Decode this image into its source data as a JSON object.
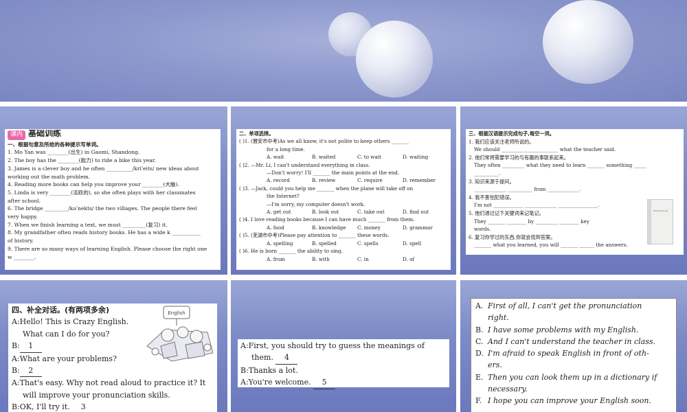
{
  "slide4": {
    "heading": "四、补全对话。(有两项多余)",
    "sign_text": "English",
    "lines": [
      {
        "a": "A:Hello! This is Crazy English.",
        "b": "What can I do for you?"
      },
      {
        "prefix": "B:",
        "blank": "1"
      },
      {
        "a": "A:What are your problems?"
      },
      {
        "prefix": "B:",
        "blank": "2"
      },
      {
        "a": "A:That's easy.  Why not read aloud to practice it? It",
        "b": "will improve your pronunciation skills."
      },
      {
        "prefix": "B:OK, I'll try it.",
        "blank": "3"
      }
    ]
  },
  "slide5": {
    "l1": "A:First, you should try to guess the meanings of",
    "l2": "them.",
    "b4": "4",
    "l3": "B:Thanks a lot.",
    "l4": "A:You're welcome.",
    "b5": "5"
  },
  "slide6": {
    "options": [
      {
        "k": "A.",
        "t": "First of all, I can't get the pronunciation",
        "c": "right."
      },
      {
        "k": "B.",
        "t": "I have some problems with my English."
      },
      {
        "k": "C.",
        "t": "And I can't understand the teacher in class."
      },
      {
        "k": "D.",
        "t": "I'm afraid to speak English in front of oth-",
        "c": "ers."
      },
      {
        "k": "E.",
        "t": "Then you can look them up in a dictionary if",
        "c": "necessary."
      },
      {
        "k": "F.",
        "t": "I hope you can improve your English soon."
      }
    ]
  },
  "slide1": {
    "badge": "课内",
    "title": "基础训练",
    "section": "一、根据句意及所给的各种提示写单词。",
    "lines": [
      "1. Mo Yan was ________(出生) in Gaomi, Shandong.",
      "2. The boy has the ________(能力) to ride a bike this year.",
      "3. James is a clever boy and he often __________/kriˈeits/ new ideas about",
      "working out the math problem.",
      "4. Reading more books can help you improve your ________(大脑).",
      "5. Linda is very ________(活跃的), so she often plays with her classmates",
      "after school.",
      "6. The bridge _________/kəˈnekts/ the two villages. The people there feel",
      "very happy.",
      "7. When we finish learning a text, we must _________(复习) it.",
      "8. My grandfather often reads history books.  He has a wide k ___________",
      "of history.",
      "9. There are so many ways of learning English.  Please choose the right one",
      "w ________."
    ]
  },
  "slide2": {
    "section": "二、单项选择。",
    "items": [
      {
        "q": "(   )1. (雅安市中考)As we all know, it's not polite to keep others _______",
        "q2": "for a long time.",
        "opts": [
          "A. wait",
          "B. waited",
          "C. to wait",
          "D. waiting"
        ]
      },
      {
        "q": "(   )2. —Mr. Li, I can't understand everything in class.",
        "q2": "—Don't worry! I'll _______ the main points at the end.",
        "opts": [
          "A. record",
          "B. review",
          "C. require",
          "D. remember"
        ]
      },
      {
        "q": "(   )3. —Jack, could you help me _______ when the plane will take off on",
        "q2": "the Internet?",
        "q3": "—I'm sorry, my computer doesn't work.",
        "opts": [
          "A. get out",
          "B. look out",
          "C. take out",
          "D. find out"
        ]
      },
      {
        "q": "(   )4. I love reading books because I can have much _______ from them.",
        "opts": [
          "A. food",
          "B. knowledge",
          "C. money",
          "D. grammar"
        ]
      },
      {
        "q": "(   )5. (芜湖市中考)Please pay attention to _______ these words.",
        "opts": [
          "A. spelling",
          "B. spelled",
          "C. spells",
          "D. spell"
        ]
      },
      {
        "q": "(   )6. He is born _______ the ability to sing.",
        "opts": [
          "A. from",
          "B. with",
          "C. in",
          "D. of"
        ]
      }
    ]
  },
  "slide3": {
    "section": "三、根据汉语提示完成句子,每空一词。",
    "lines": [
      "1. 我们应该关注老师所说的。",
      "We should _______________________ what the teacher said.",
      "2. 他们常将需要学习的与有趣的事联系起来。",
      "They often _________ what they need to learn _______ something _____",
      "__________.",
      "3. 知识来源于提问。",
      "_____________ __________ from _____________.",
      "4. 我不害怕犯错误。",
      "I'm not ____________ _____________ ________________.",
      "5. 他们通过记下关键词来记笔记。",
      "They _______ ________ by _________ ________ key",
      "words.",
      "6. 复习你学过的东西,你就会找到答案。",
      "_______ what you learned, you will _______ ______ the answers."
    ],
    "notebook_label": "Exercise book"
  }
}
